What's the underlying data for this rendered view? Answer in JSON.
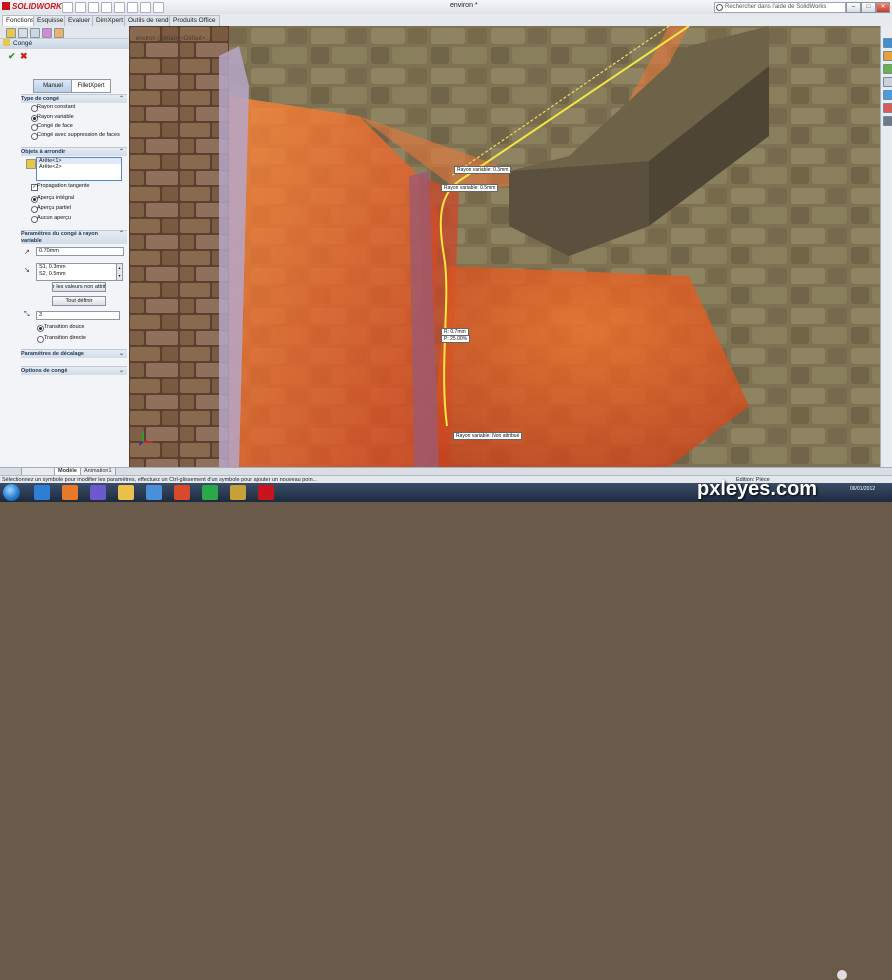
{
  "app": {
    "brand": "SOLIDWORKS",
    "document_title": "environ *",
    "search_placeholder": "Rechercher dans l'aide de SolidWorks"
  },
  "command_tabs": [
    "Fonctions",
    "Esquisse",
    "Evaluer",
    "DimXpert",
    "Outils de rendu",
    "Produits Office"
  ],
  "property_manager": {
    "title": "Congé",
    "mode_buttons": [
      "Manuel",
      "FilletXpert"
    ],
    "type_group": {
      "title": "Type de congé",
      "options": [
        "Rayon constant",
        "Rayon variable",
        "Congé de face",
        "Congé avec suppression de faces"
      ],
      "selected": "Rayon variable"
    },
    "items_group": {
      "title": "Objets à arrondir",
      "items": [
        "Arête<1>",
        "Arête<2>"
      ],
      "propagation_label": "Propagation tangente",
      "preview_options": [
        "Aperçu intégral",
        "Aperçu partiel",
        "Aucun aperçu"
      ],
      "preview_selected": "Aperçu intégral"
    },
    "variable_group": {
      "title": "Paramètres du congé à rayon variable",
      "radius_value": "0.70mm",
      "radius_list": [
        "S1, 0.3mm",
        "S2, 0.5mm"
      ],
      "unassigned_button": "r les valeurs non attrit",
      "set_all_button": "Tout définir",
      "instances_value": "3",
      "transition_options": [
        "Transition douce",
        "Transition directe"
      ],
      "transition_selected": "Transition douce"
    },
    "setback_group": {
      "title": "Paramètres de décalage"
    },
    "fillet_options_group": {
      "title": "Options de congé"
    }
  },
  "viewport": {
    "breadcrumb": "environ (Défaut<<Défaut>...",
    "callouts": {
      "rayon_1": "Rayon variable: 0.3mm",
      "rayon_2": "Rayon variable: 0.5mm",
      "point_r": "R: 0.7mm",
      "point_p": "P: 25.00%",
      "rayon_3": "Rayon variable: Non attribué"
    }
  },
  "bottom_tabs": [
    "Modèle",
    "Animation1"
  ],
  "status": {
    "left": "Sélectionnez un symbole pour modifier les paramètres, effectuez un Ctrl-glissement d'un symbole pour ajouter un nouveau poin...",
    "right": "Edition: Pièce"
  },
  "watermark": "pxleyes.com",
  "clock": {
    "date": "06/01/2012"
  },
  "colors": {
    "accent": "#c8141c",
    "fillet_orange": "#e8591c",
    "edge_yellow": "#f2e640",
    "stone": "#7a6a4e"
  }
}
